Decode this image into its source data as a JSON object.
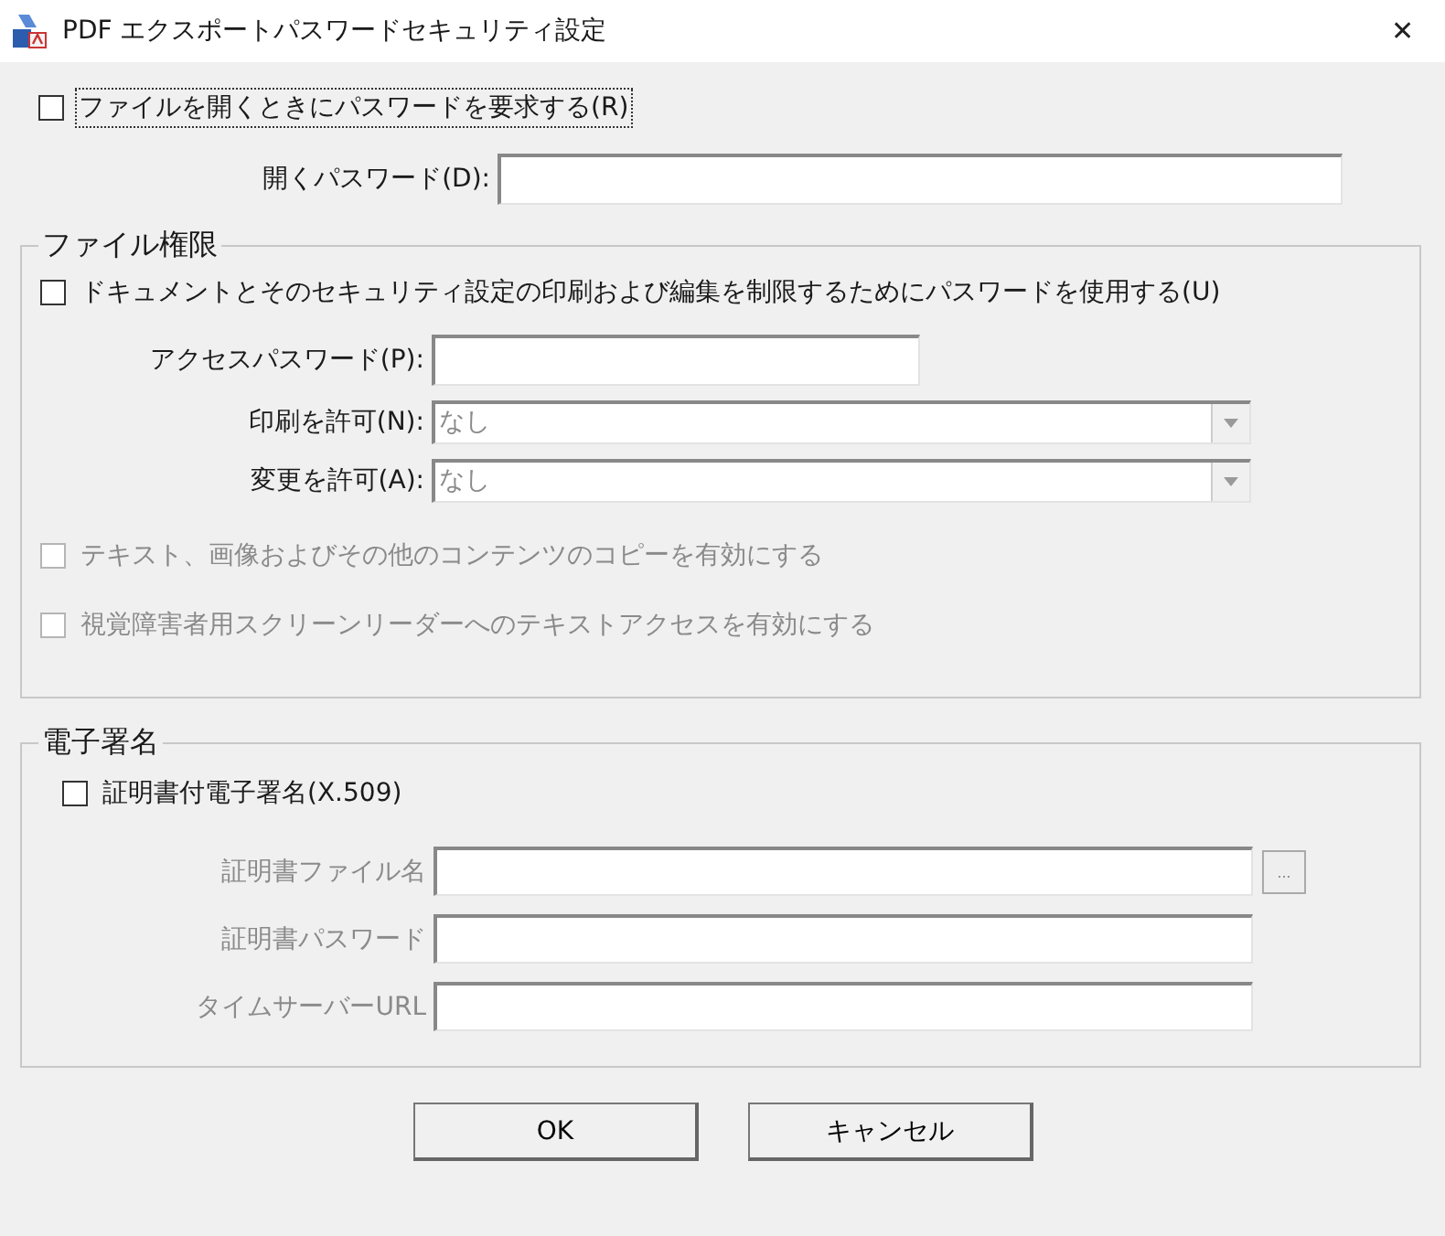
{
  "window": {
    "title": "PDF エクスポートパスワードセキュリティ設定",
    "close": "✕"
  },
  "open_password": {
    "checkbox": {
      "label": "ファイルを開くときにパスワードを要求する(R)",
      "checked": false,
      "disabled": false,
      "focused": true
    },
    "field": {
      "label": "開くパスワード(D):",
      "disabled": false
    }
  },
  "permissions": {
    "title": "ファイル権限",
    "checkbox": {
      "label": "ドキュメントとそのセキュリティ設定の印刷および編集を制限するためにパスワードを使用する(U)",
      "checked": false,
      "disabled": false
    },
    "fields": [
      {
        "kind": "text",
        "label": "アクセスパスワード(P):",
        "disabled": false
      },
      {
        "kind": "combo",
        "label": "印刷を許可(N):",
        "value": "なし",
        "disabled": true
      },
      {
        "kind": "combo",
        "label": "変更を許可(A):",
        "value": "なし",
        "disabled": true
      }
    ],
    "options": [
      {
        "label": "テキスト、画像およびその他のコンテンツのコピーを有効にする",
        "checked": false,
        "disabled": true
      },
      {
        "label": "視覚障害者用スクリーンリーダーへのテキストアクセスを有効にする",
        "checked": false,
        "disabled": true
      }
    ]
  },
  "signature": {
    "title": "電子署名",
    "checkbox": {
      "label": "証明書付電子署名(X.509)",
      "checked": false,
      "disabled": false
    },
    "fields": [
      {
        "label": "証明書ファイル名",
        "disabled": true,
        "browse": "..."
      },
      {
        "label": "証明書パスワード",
        "disabled": true
      },
      {
        "label": "タイムサーバーURL",
        "disabled": true
      }
    ]
  },
  "buttons": [
    "OK",
    "キャンセル"
  ]
}
